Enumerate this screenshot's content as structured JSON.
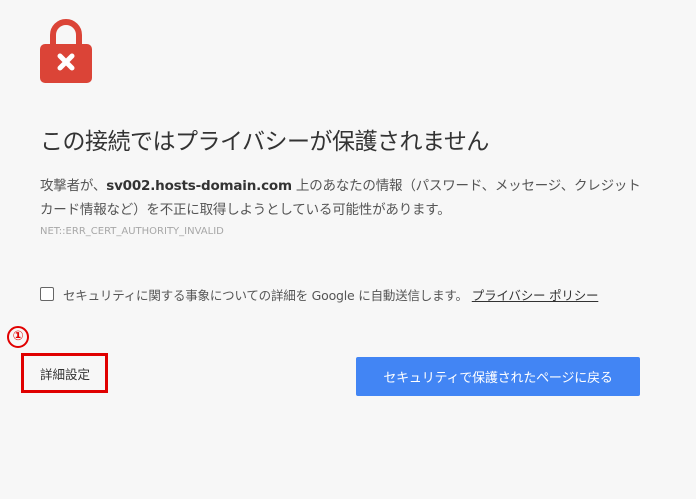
{
  "colors": {
    "background": "#f7f7f7",
    "lock": "#db4437",
    "primary_button": "#4285f4",
    "annotation": "#e00000"
  },
  "icons": {
    "status": "lock-error-icon"
  },
  "heading": "この接続ではプライバシーが保護されません",
  "message": {
    "prefix": "攻撃者が、",
    "domain": "sv002.hosts-domain.com",
    "suffix": " 上のあなたの情報（パスワード、メッセージ、クレジット カード情報など）を不正に取得しようとしている可能性があります。"
  },
  "error_code": "NET::ERR_CERT_AUTHORITY_INVALID",
  "report": {
    "checked": false,
    "label": "セキュリティに関する事象についての詳細を Google に自動送信します。",
    "link": "プライバシー ポリシー"
  },
  "annotation": {
    "marker": "①"
  },
  "buttons": {
    "details": "詳細設定",
    "back_to_safety": "セキュリティで保護されたページに戻る"
  }
}
